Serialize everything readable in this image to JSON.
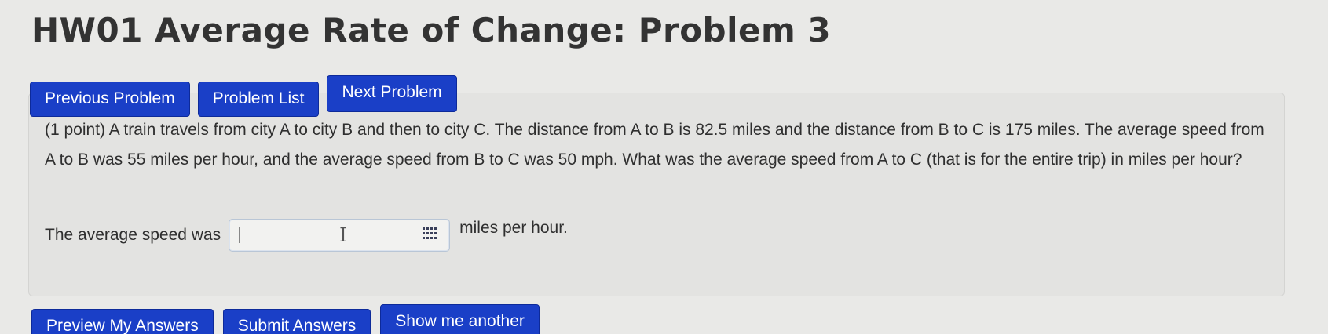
{
  "page": {
    "title": "HW01 Average Rate of Change: Problem 3"
  },
  "nav": {
    "previous_label": "Previous Problem",
    "list_label": "Problem List",
    "next_label": "Next Problem"
  },
  "problem": {
    "text": "(1 point) A train travels from city A to city B and then to city C. The distance from A to B is 82.5 miles and the distance from B to C is 175 miles. The average speed from A to B was 55 miles per hour, and the average speed from B to C was 50 mph. What was the average speed from A to C (that is for the entire trip) in miles per hour?",
    "answer_prefix": "The average speed was",
    "answer_value": "",
    "answer_suffix": "miles per hour."
  },
  "actions": {
    "preview_label": "Preview My Answers",
    "submit_label": "Submit Answers",
    "show_another_label": "Show me another"
  },
  "icons": {
    "keypad": "keypad-icon",
    "cursor": "text-cursor-icon"
  },
  "colors": {
    "button_blue": "#1a3fc7",
    "background": "#e9e9e7"
  }
}
